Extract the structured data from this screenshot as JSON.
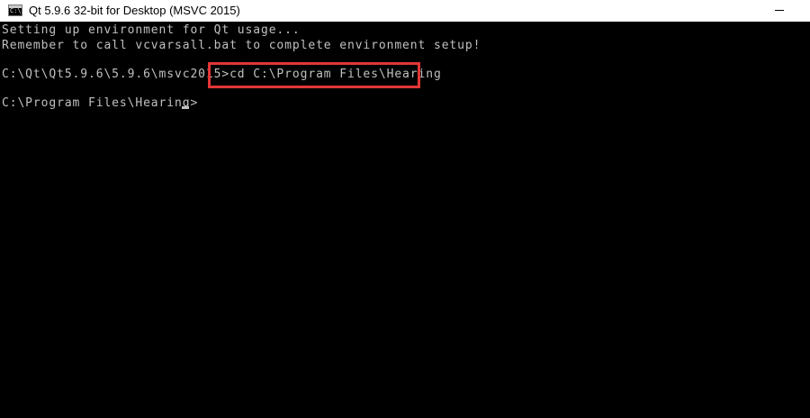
{
  "window": {
    "title": "Qt 5.9.6 32-bit for Desktop (MSVC 2015)",
    "icon": "console-icon",
    "icon_glyph": "C:\\"
  },
  "console": {
    "lines": [
      "Setting up environment for Qt usage...",
      "Remember to call vcvarsall.bat to complete environment setup!",
      "",
      "C:\\Qt\\Qt5.9.6\\5.9.6\\msvc2015>cd C:\\Program Files\\Hearing",
      "",
      "C:\\Program Files\\Hearing>"
    ],
    "foreground_color": "#c0c0c0",
    "background_color": "#000000",
    "highlight_color": "#e23636"
  }
}
